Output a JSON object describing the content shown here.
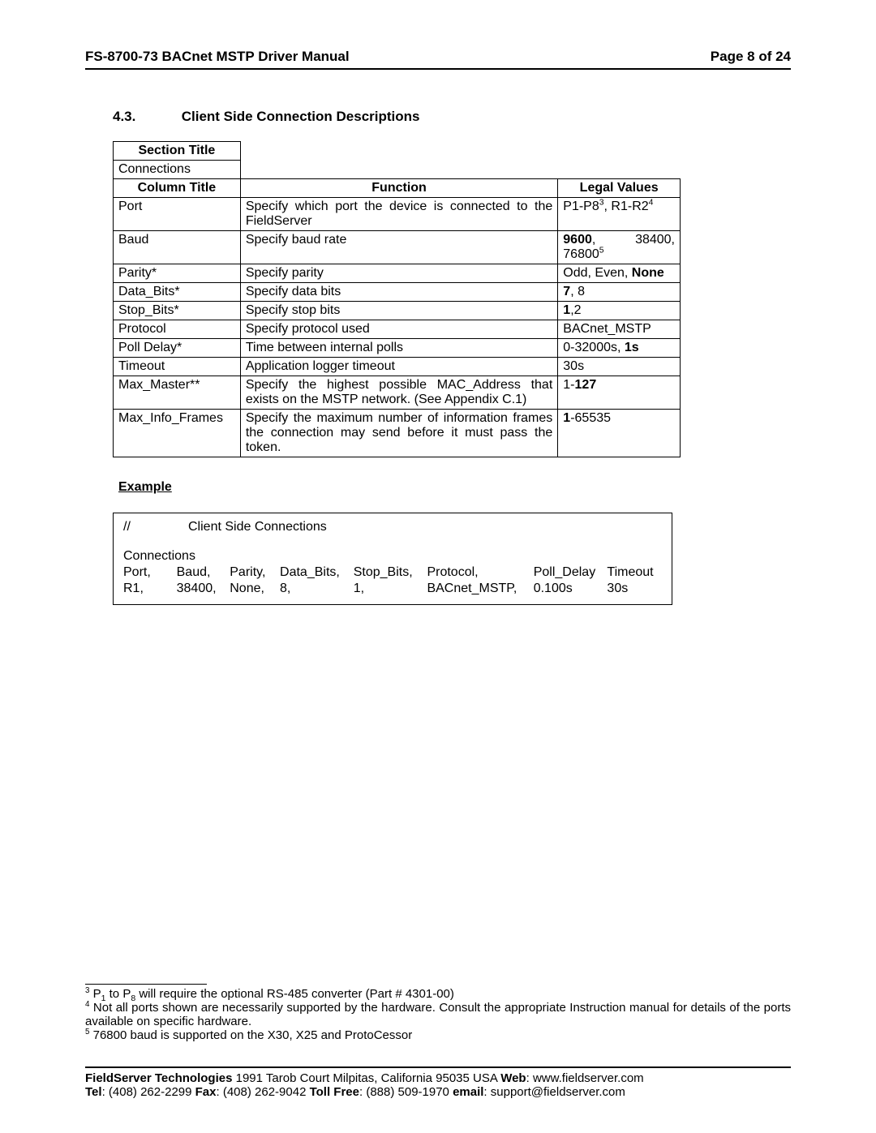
{
  "header": {
    "left": "FS-8700-73 BACnet MSTP Driver Manual",
    "right": "Page 8 of 24"
  },
  "section": {
    "number": "4.3.",
    "title": "Client Side Connection Descriptions"
  },
  "table": {
    "section_title_label": "Section Title",
    "section_title_value": "Connections",
    "headers": {
      "col_title": "Column Title",
      "function": "Function",
      "legal": "Legal Values"
    },
    "rows": [
      {
        "title": "Port",
        "func": "Specify which port the device is connected to the FieldServer",
        "legal": {
          "pre": "P1-P8",
          "sup1": "3",
          "mid": ", R1-R2",
          "sup2": "4"
        }
      },
      {
        "title": "Baud",
        "func": "Specify baud rate",
        "legal_baud": {
          "a": "9600",
          "b": ", 38400, 76800",
          "sup": "5"
        }
      },
      {
        "title": "Parity*",
        "func": "Specify parity",
        "legal_plain": {
          "pre": "Odd, Even, ",
          "bold": "None"
        }
      },
      {
        "title": "Data_Bits*",
        "func": "Specify data bits",
        "legal_plain": {
          "pre": "",
          "bold": "7",
          "post": ", 8"
        }
      },
      {
        "title": "Stop_Bits*",
        "func": "Specify stop bits",
        "legal_plain": {
          "pre": "",
          "bold": "1",
          "post": ",2"
        }
      },
      {
        "title": "Protocol",
        "func": "Specify protocol used",
        "legal_plain": {
          "pre": "BACnet_MSTP",
          "bold": "",
          "post": ""
        }
      },
      {
        "title": "Poll Delay*",
        "func": "Time between internal polls",
        "legal_plain": {
          "pre": "0-32000s, ",
          "bold": "1s"
        }
      },
      {
        "title": "Timeout",
        "func": "Application logger timeout",
        "legal_plain": {
          "pre": "30s",
          "bold": ""
        }
      },
      {
        "title": "Max_Master**",
        "func": "Specify the highest possible MAC_Address that exists on the MSTP network.  (See Appendix C.1)",
        "legal_plain": {
          "pre": "1-",
          "bold": "127"
        }
      },
      {
        "title": "Max_Info_Frames",
        "func": "Specify the maximum number of information frames the connection may send before it must pass the token.",
        "legal_plain": {
          "pre": "",
          "bold": "1",
          "post": "-65535"
        }
      }
    ]
  },
  "example": {
    "label": "Example",
    "slashes": "//",
    "comment": "Client Side Connections",
    "connections_word": "Connections",
    "headers": [
      "Port,",
      "Baud,",
      "Parity,",
      "Data_Bits,",
      "Stop_Bits,",
      "Protocol,",
      "Poll_Delay",
      "Timeout"
    ],
    "values": [
      "R1,",
      "38400,",
      "None,",
      "8,",
      "1,",
      "BACnet_MSTP,",
      "0.100s",
      "30s"
    ]
  },
  "footnotes": {
    "f3": {
      "sup": "3",
      "pre": " P",
      "sub1": "1",
      "mid": " to P",
      "sub2": "8",
      "post": " will require the optional RS-485 converter (Part # 4301-00)"
    },
    "f4": {
      "sup": "4",
      "text": " Not all ports shown are necessarily supported by the hardware. Consult the appropriate Instruction manual for details of the ports available on specific hardware."
    },
    "f5": {
      "sup": "5",
      "text": " 76800 baud is supported on the X30, X25 and ProtoCessor"
    }
  },
  "footer": {
    "line1": {
      "company": "FieldServer Technologies",
      "addr": " 1991 Tarob Court Milpitas, California 95035 USA   ",
      "web_lbl": "Web",
      "web": ": www.fieldserver.com"
    },
    "line2": {
      "tel_lbl": "Tel",
      "tel": ": (408) 262-2299   ",
      "fax_lbl": "Fax",
      "fax": ": (408) 262-9042   ",
      "tf_lbl": "Toll Free",
      "tf": ": (888) 509-1970   ",
      "em_lbl": "email",
      "em": ": support@fieldserver.com"
    }
  }
}
